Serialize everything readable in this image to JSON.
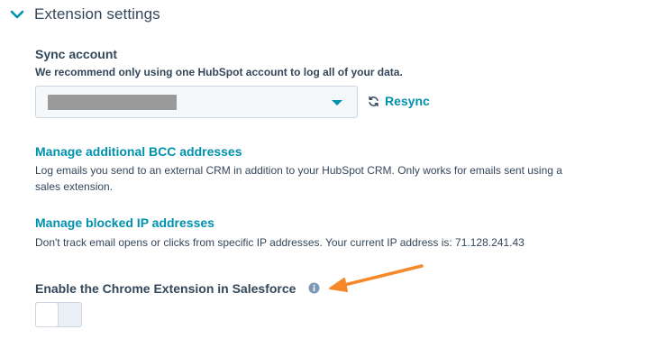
{
  "section": {
    "title": "Extension settings"
  },
  "sync": {
    "label": "Sync account",
    "help": "We recommend only using one HubSpot account to log all of your data.",
    "selected_account": "",
    "resync_label": "Resync"
  },
  "bcc": {
    "link_label": "Manage additional BCC addresses",
    "help": "Log emails you send to an external CRM in addition to your HubSpot CRM. Only works for emails sent using a sales extension."
  },
  "blocked_ip": {
    "link_label": "Manage blocked IP addresses",
    "help": "Don't track email opens or clicks from specific IP addresses. Your current IP address is: 71.128.241.43"
  },
  "chrome_ext": {
    "label": "Enable the Chrome Extension in Salesforce",
    "enabled": false
  },
  "colors": {
    "text": "#33475b",
    "link": "#0091ae",
    "arrow": "#f5892a",
    "border": "#cbd6e2"
  },
  "icons": [
    "chevron-down-icon",
    "dropdown-caret-icon",
    "refresh-icon",
    "info-icon",
    "arrow-annotation"
  ]
}
